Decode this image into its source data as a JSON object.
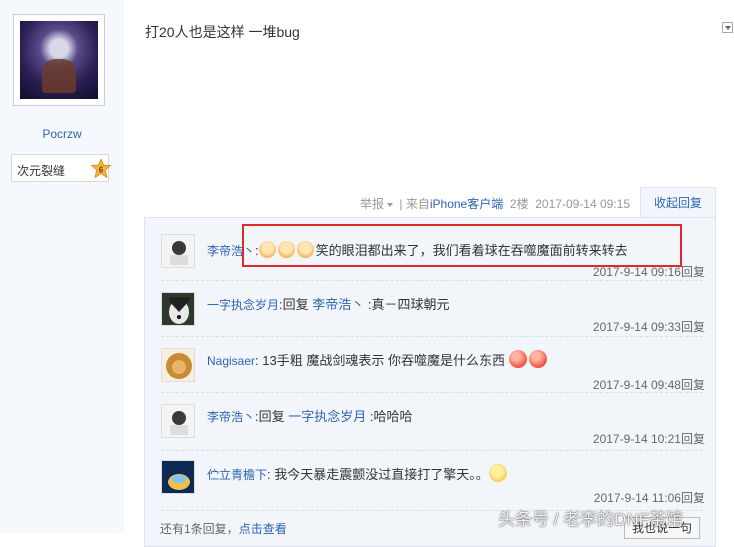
{
  "author": {
    "name": "Pocrzw",
    "badge_label": "次元裂缝",
    "badge_level": "6"
  },
  "post": {
    "text": "打20人也是这样 一堆bug"
  },
  "meta": {
    "report": "举报",
    "source_prefix": "| 来自",
    "source_link": "iPhone客户端",
    "floor": "2楼",
    "datetime": "2017-09-14 09:15",
    "collapse": "收起回复"
  },
  "replies": [
    {
      "name": "李帝浩丶",
      "sep": ":",
      "prefix": "",
      "target": "",
      "after_target": "",
      "emoji_before": [
        "laugh",
        "laugh",
        "laugh"
      ],
      "text": "笑的眼泪都出来了，我们看着球在吞噬魔面前转来转去",
      "emoji_after": [],
      "time": "2017-9-14 09:16",
      "reply_label": "回复"
    },
    {
      "name": "一字执念岁月",
      "sep": ":",
      "prefix": "回复 ",
      "target": "李帝浩丶",
      "after_target": " :",
      "emoji_before": [],
      "text": "真－四球朝元",
      "emoji_after": [],
      "time": "2017-9-14 09:33",
      "reply_label": "回复"
    },
    {
      "name": "Nagisaer",
      "sep": ":",
      "prefix": "",
      "target": "",
      "after_target": "",
      "emoji_before": [],
      "text": " 13手粗 魔战剑魂表示 你吞噬魔是什么东西 ",
      "emoji_after": [
        "red",
        "red"
      ],
      "time": "2017-9-14 09:48",
      "reply_label": "回复"
    },
    {
      "name": "李帝浩丶",
      "sep": ":",
      "prefix": "回复 ",
      "target": "一字执念岁月",
      "after_target": " :",
      "emoji_before": [],
      "text": "哈哈哈",
      "emoji_after": [],
      "time": "2017-9-14 10:21",
      "reply_label": "回复"
    },
    {
      "name": "伫立青檐下",
      "sep": ":",
      "prefix": "",
      "target": "",
      "after_target": "",
      "emoji_before": [],
      "text": " 我今天暴走震颤没过直接打了擎天。。",
      "emoji_after": [
        "smile"
      ],
      "time": "2017-9-14 11:06",
      "reply_label": "回复"
    }
  ],
  "footer": {
    "more_text": "还有1条回复，",
    "more_link": "点击查看",
    "say_button": "我也说一句"
  },
  "watermark": "头条号 / 老李的DNF茶馆"
}
